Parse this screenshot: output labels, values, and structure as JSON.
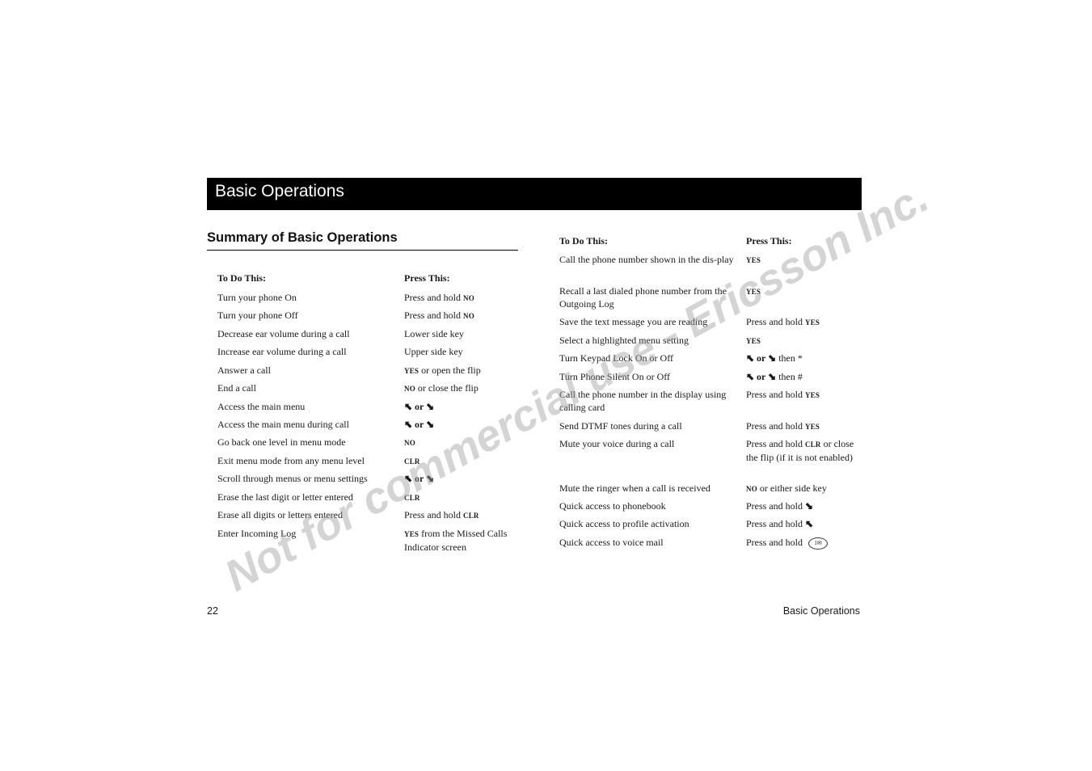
{
  "header": {
    "title": "Basic Operations"
  },
  "section": {
    "title": "Summary of Basic Operations"
  },
  "left_table": {
    "col1_header": "To Do This:",
    "col2_header": "Press This:",
    "rows": [
      {
        "action": "Turn your phone On",
        "press_prefix": "Press and hold ",
        "press_key": "NO",
        "press_suffix": ""
      },
      {
        "action": "Turn your phone Off",
        "press_prefix": "Press and hold ",
        "press_key": "NO",
        "press_suffix": ""
      },
      {
        "action": "Decrease ear volume during a call",
        "press_prefix": "Lower side key",
        "press_key": "",
        "press_suffix": ""
      },
      {
        "action": "Increase ear volume during a call",
        "press_prefix": "Upper side key",
        "press_key": "",
        "press_suffix": ""
      },
      {
        "action": "Answer a call",
        "press_prefix": "",
        "press_key": "YES",
        "press_suffix": " or open the flip"
      },
      {
        "action": "End a call",
        "press_prefix": "",
        "press_key": "NO",
        "press_suffix": " or close the flip"
      },
      {
        "action": "Access the main menu",
        "press_prefix": "",
        "press_key": "⬉ or ⬊",
        "press_suffix": ""
      },
      {
        "action": "Access the main menu during call",
        "press_prefix": "",
        "press_key": "⬉ or ⬊",
        "press_suffix": ""
      },
      {
        "action": "Go back one level in menu mode",
        "press_prefix": "",
        "press_key": "NO",
        "press_suffix": ""
      },
      {
        "action": "Exit menu mode from any menu level",
        "press_prefix": "",
        "press_key": "CLR",
        "press_suffix": ""
      },
      {
        "action": "Scroll through menus or menu settings",
        "press_prefix": "",
        "press_key": "⬉ or ⬊",
        "press_suffix": ""
      },
      {
        "action": "Erase the last digit or letter entered",
        "press_prefix": "",
        "press_key": "CLR",
        "press_suffix": ""
      },
      {
        "action": "Erase all digits or letters entered",
        "press_prefix": "Press and hold ",
        "press_key": "CLR",
        "press_suffix": ""
      },
      {
        "action": "Enter Incoming Log",
        "press_prefix": "",
        "press_key": "YES",
        "press_suffix": " from the Missed Calls Indicator screen"
      }
    ]
  },
  "right_table": {
    "col1_header": "To Do This:",
    "col2_header": "Press This:",
    "rows": [
      {
        "action": "Call the phone number shown in the dis-play",
        "press_prefix": "",
        "press_key": "YES",
        "press_suffix": ""
      },
      {
        "action": "Recall a last dialed phone number from the Outgoing Log",
        "press_prefix": "",
        "press_key": "YES",
        "press_suffix": ""
      },
      {
        "action": "Save the text message you are reading",
        "press_prefix": "Press and hold ",
        "press_key": "YES",
        "press_suffix": ""
      },
      {
        "action": "Select a highlighted menu setting",
        "press_prefix": "",
        "press_key": "YES",
        "press_suffix": ""
      },
      {
        "action": "Turn Keypad Lock On or Off",
        "press_prefix": "",
        "press_key": "⬉ or ⬊",
        "press_suffix": " then *"
      },
      {
        "action": "Turn Phone Silent On or Off",
        "press_prefix": "",
        "press_key": "⬉ or ⬊",
        "press_suffix": " then #"
      },
      {
        "action": "Call the phone number in the display using calling card",
        "press_prefix": "Press and hold ",
        "press_key": "YES",
        "press_suffix": ""
      },
      {
        "action": "Send DTMF tones during a call",
        "press_prefix": "Press and hold ",
        "press_key": "YES",
        "press_suffix": ""
      },
      {
        "action": "Mute your voice during a call",
        "press_prefix": "Press and hold ",
        "press_key": "CLR",
        "press_suffix": " or close the flip (if it is not enabled)"
      },
      {
        "action": "Mute the ringer when a call is received",
        "press_prefix": "",
        "press_key": "NO",
        "press_suffix": " or either side key"
      },
      {
        "action": "Quick access to phonebook",
        "press_prefix": "Press and hold ",
        "press_key": "⬊",
        "press_suffix": ""
      },
      {
        "action": "Quick access to profile activation",
        "press_prefix": "Press and hold ",
        "press_key": "⬉",
        "press_suffix": ""
      },
      {
        "action": "Quick access to voice mail",
        "press_prefix": "Press and hold ",
        "press_key": "",
        "press_suffix": "",
        "voicemail_key_glyph": "1✉"
      }
    ]
  },
  "footer": {
    "page_number": "22",
    "section_name": "Basic Operations"
  },
  "watermark": {
    "text": "Not for commercial use - Ericsson Inc."
  }
}
